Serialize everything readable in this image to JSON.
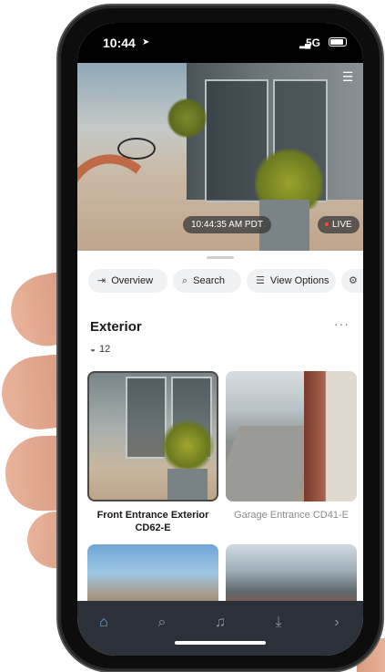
{
  "status_bar": {
    "time": "10:44",
    "network": "5G"
  },
  "live_view": {
    "timestamp": "10:44:35 AM PDT",
    "live_label": "LIVE",
    "live_dot_color": "#ff4040"
  },
  "toolbar": {
    "overview": "Overview",
    "search": "Search",
    "view_options": "View Options"
  },
  "group": {
    "title": "Exterior",
    "more": "···",
    "camera_count": "12"
  },
  "cameras": [
    {
      "name": "Front Entrance Exterior CD62-E",
      "selected": true
    },
    {
      "name": "Garage Entrance CD41-E",
      "selected": false
    }
  ],
  "tabbar": {
    "active_color": "#6fa8e8",
    "items": [
      "home-icon",
      "search-icon",
      "bell-icon",
      "download-icon",
      "chevron-right-icon"
    ]
  }
}
